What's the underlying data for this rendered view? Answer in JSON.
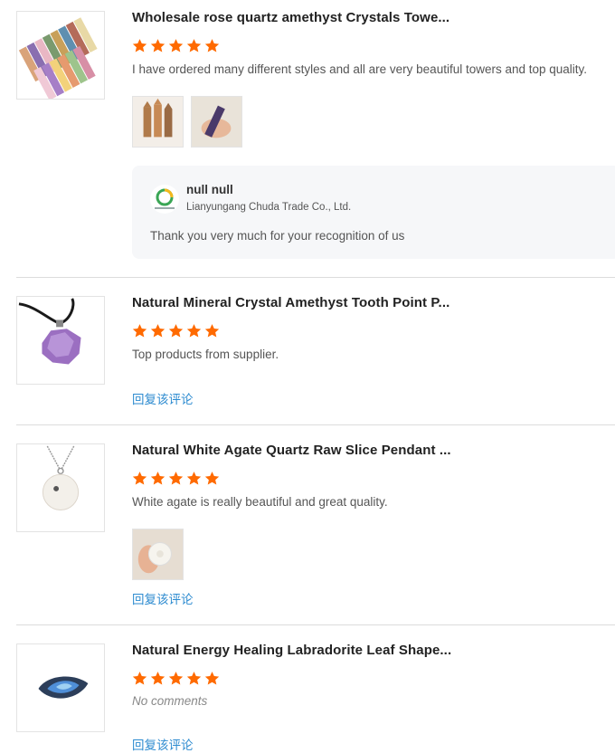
{
  "reviews": [
    {
      "title": "Wholesale rose quartz amethyst Crystals Towe...",
      "rating": 5,
      "comment": "I have ordered many different styles and all are very beautiful towers and top quality.",
      "seller_reply": {
        "name": "null null",
        "company": "Lianyungang Chuda Trade Co., Ltd.",
        "text": "Thank you very much for your recognition of us"
      }
    },
    {
      "title": "Natural Mineral Crystal Amethyst Tooth Point P...",
      "rating": 5,
      "comment": "Top products from supplier.",
      "reply_link": "回复该评论"
    },
    {
      "title": "Natural White Agate Quartz Raw Slice Pendant ...",
      "rating": 5,
      "comment": "White agate is really beautiful and great quality.",
      "reply_link": "回复该评论"
    },
    {
      "title": "Natural Energy Healing Labradorite Leaf Shape...",
      "rating": 5,
      "comment": "No comments",
      "reply_link": "回复该评论"
    }
  ],
  "colors": {
    "star": "#ff6a00",
    "link": "#2d8bd0"
  }
}
